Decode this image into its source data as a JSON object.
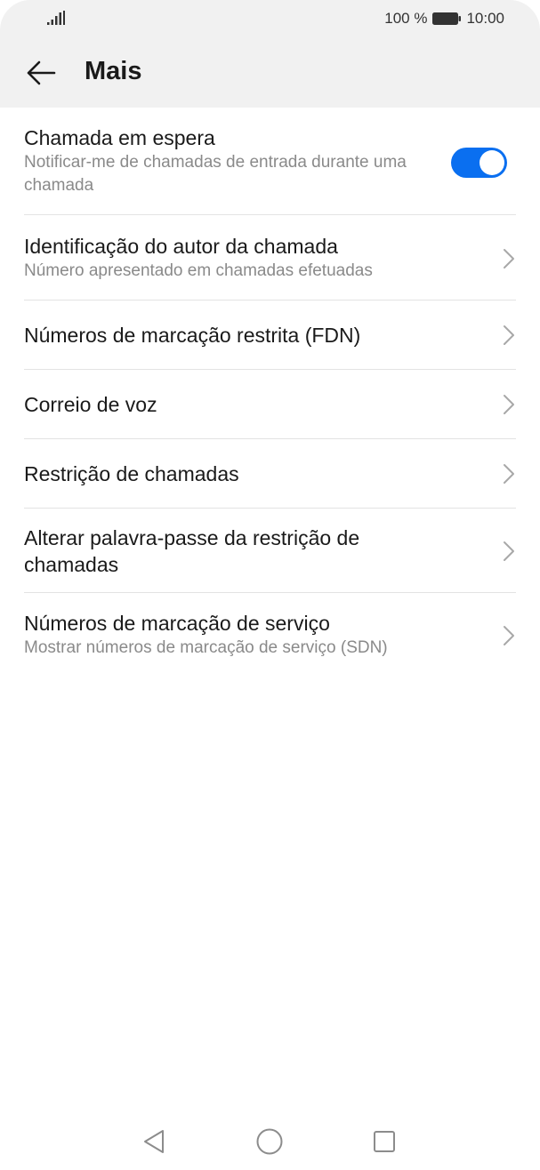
{
  "status_bar": {
    "battery_text": "100 %",
    "time": "10:00"
  },
  "header": {
    "title": "Mais"
  },
  "items": [
    {
      "title": "Chamada em espera",
      "subtitle": "Notificar-me de chamadas de entrada durante uma chamada",
      "control": "toggle",
      "toggle_on": true
    },
    {
      "title": "Identificação do autor da chamada",
      "subtitle": "Número apresentado em chamadas efetuadas",
      "control": "chevron"
    },
    {
      "title": "Números de marcação restrita (FDN)",
      "control": "chevron"
    },
    {
      "title": "Correio de voz",
      "control": "chevron"
    },
    {
      "title": "Restrição de chamadas",
      "control": "chevron"
    },
    {
      "title": "Alterar palavra-passe da restrição de chamadas",
      "control": "chevron"
    },
    {
      "title": "Números de marcação de serviço",
      "subtitle": "Mostrar números de marcação de serviço (SDN)",
      "control": "chevron"
    }
  ],
  "icons": {
    "back": "back-arrow-icon",
    "signal": "signal-icon",
    "battery": "battery-icon",
    "chevron": "chevron-right-icon",
    "nav_back": "nav-back-icon",
    "nav_home": "nav-home-icon",
    "nav_recents": "nav-recents-icon"
  },
  "colors": {
    "accent": "#0a6ff0",
    "header_bg": "#f1f1f1"
  }
}
